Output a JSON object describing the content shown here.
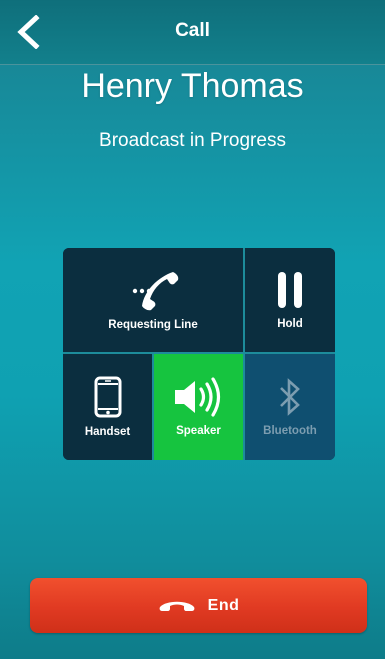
{
  "header": {
    "title": "Call",
    "back_icon": "chevron-left-icon"
  },
  "call": {
    "caller_name": "Henry Thomas",
    "status": "Broadcast in Progress"
  },
  "controls": {
    "requesting_line": {
      "label": "Requesting Line",
      "icon": "phone-requesting-icon"
    },
    "hold": {
      "label": "Hold",
      "icon": "pause-icon"
    },
    "handset": {
      "label": "Handset",
      "icon": "smartphone-icon"
    },
    "speaker": {
      "label": "Speaker",
      "icon": "speaker-icon",
      "active": true
    },
    "bluetooth": {
      "label": "Bluetooth",
      "icon": "bluetooth-icon",
      "enabled": false
    }
  },
  "end_button": {
    "label": "End",
    "icon": "hang-up-icon"
  },
  "colors": {
    "background": "#11a3b4",
    "panel": "#0b2e3f",
    "speaker_active": "#16c43f",
    "bluetooth_disabled": "#0f4f70",
    "end_button": "#e03a22"
  }
}
